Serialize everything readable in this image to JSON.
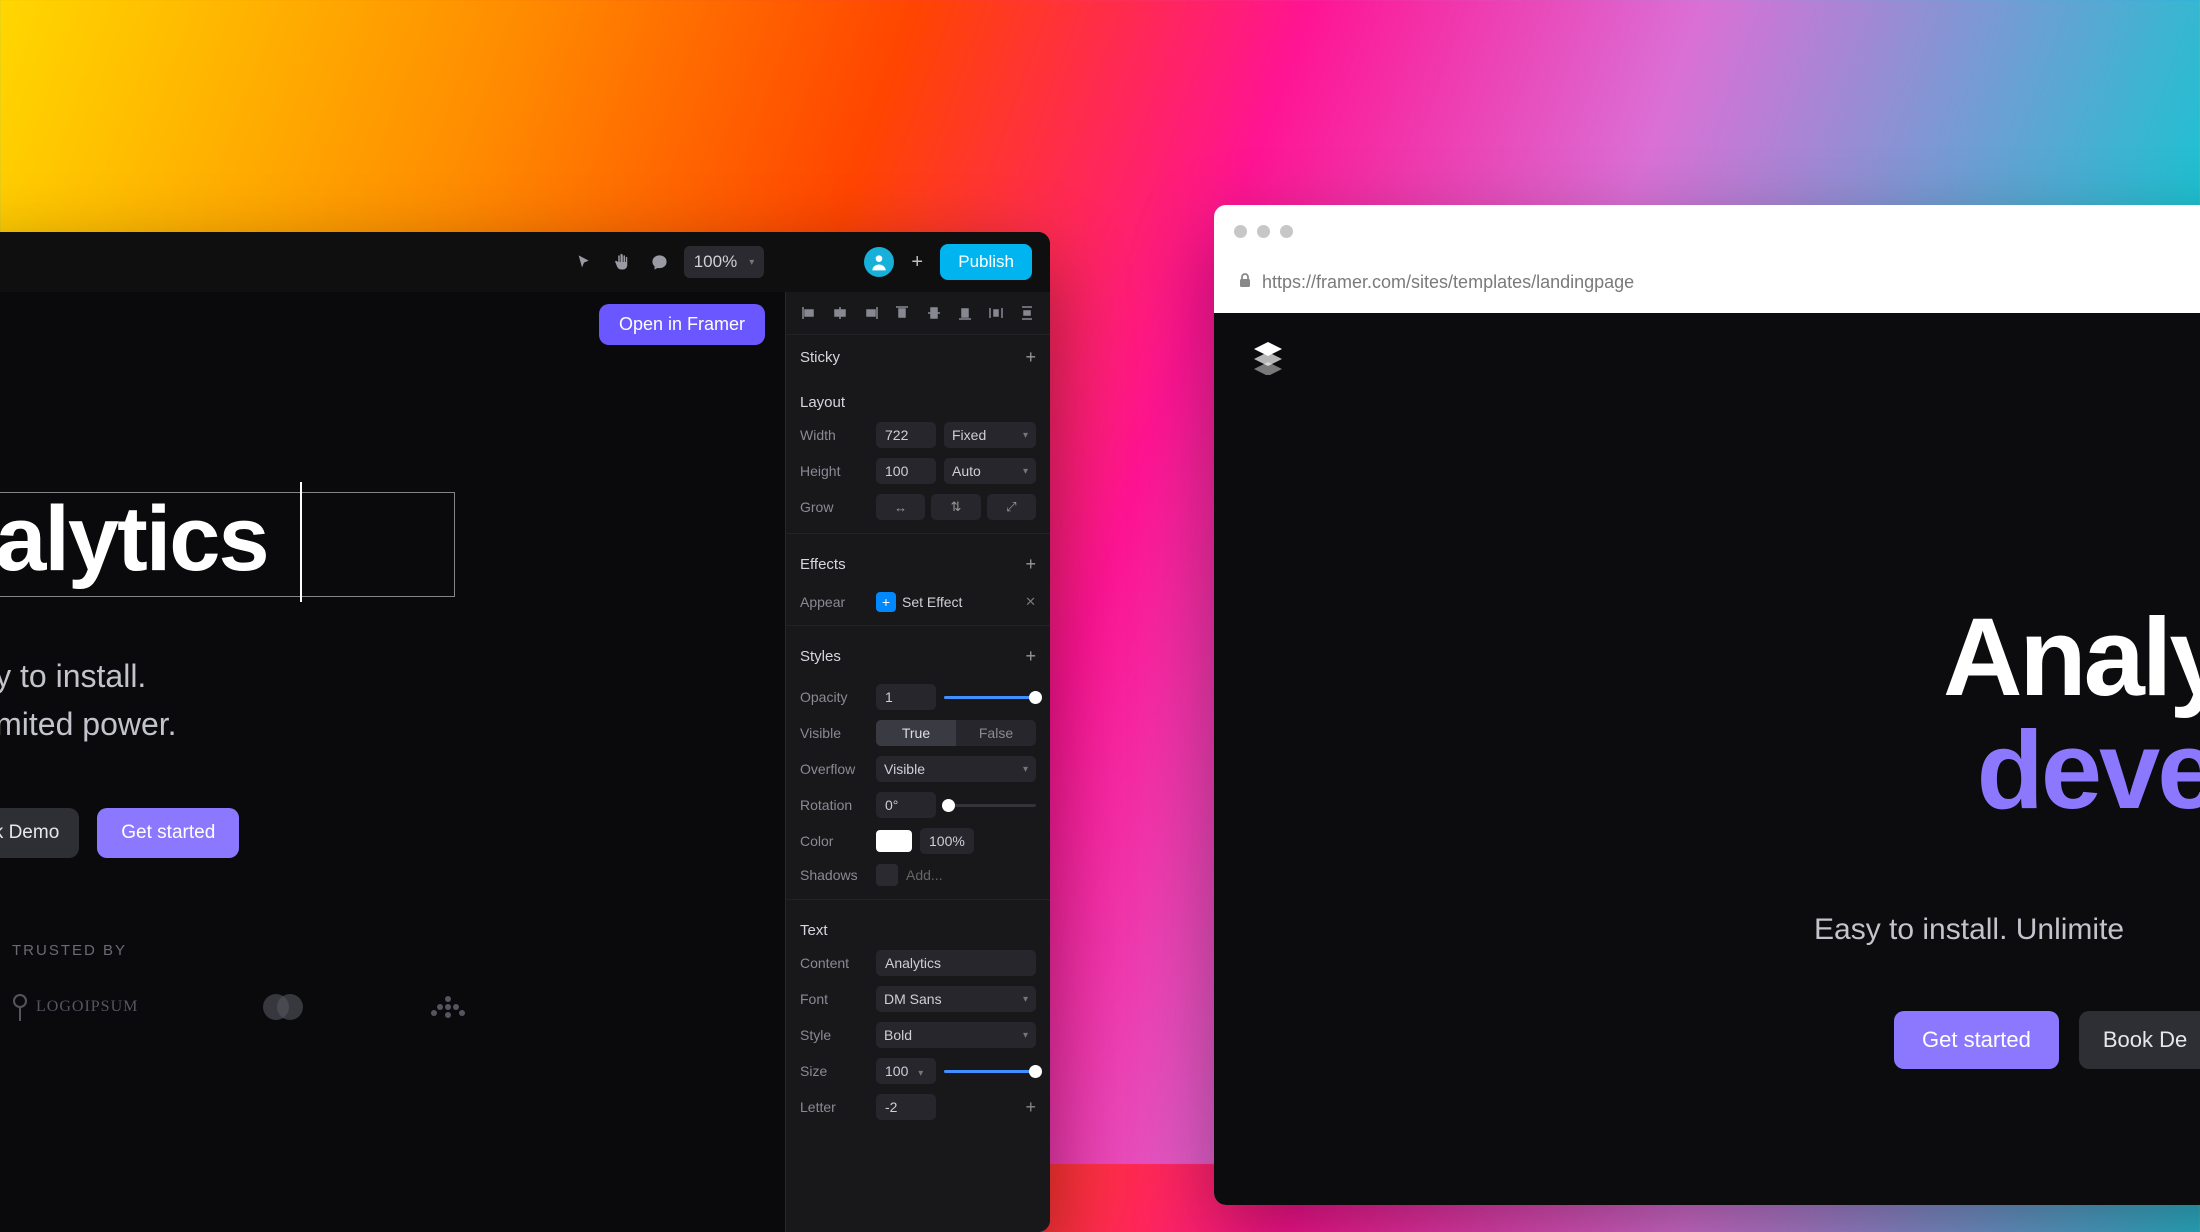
{
  "editor": {
    "toolbar": {
      "zoom": "100%",
      "publish": "Publish",
      "open_in_framer": "Open in Framer"
    },
    "canvas": {
      "selected_heading": "nalytics",
      "subheading_l1": "Easy to install.",
      "subheading_l2": "Unlimited power.",
      "cta_secondary": "Book Demo",
      "cta_primary": "Get started",
      "trusted_label": "TRUSTED BY",
      "logo1": "LOGOIPSUM"
    },
    "panel": {
      "sticky_label": "Sticky",
      "layout_label": "Layout",
      "width_label": "Width",
      "width_value": "722",
      "width_mode": "Fixed",
      "height_label": "Height",
      "height_value": "100",
      "height_mode": "Auto",
      "grow_label": "Grow",
      "effects_label": "Effects",
      "appear_label": "Appear",
      "appear_value": "Set Effect",
      "styles_label": "Styles",
      "opacity_label": "Opacity",
      "opacity_value": "1",
      "visible_label": "Visible",
      "visible_true": "True",
      "visible_false": "False",
      "overflow_label": "Overflow",
      "overflow_value": "Visible",
      "rotation_label": "Rotation",
      "rotation_value": "0°",
      "color_label": "Color",
      "color_value": "100%",
      "shadows_label": "Shadows",
      "shadows_add": "Add...",
      "text_label": "Text",
      "content_label": "Content",
      "content_value": "Analytics",
      "font_label": "Font",
      "font_value": "DM Sans",
      "style_label": "Style",
      "style_value": "Bold",
      "size_label": "Size",
      "size_value": "100",
      "letter_label": "Letter",
      "letter_value": "-2"
    }
  },
  "browser": {
    "url": "https://framer.com/sites/templates/landingpage",
    "page": {
      "heading_l1": "Analytics",
      "heading_l2": "develop",
      "subheading": "Easy to install. Unlimite",
      "cta_primary": "Get started",
      "cta_secondary": "Book De"
    }
  }
}
